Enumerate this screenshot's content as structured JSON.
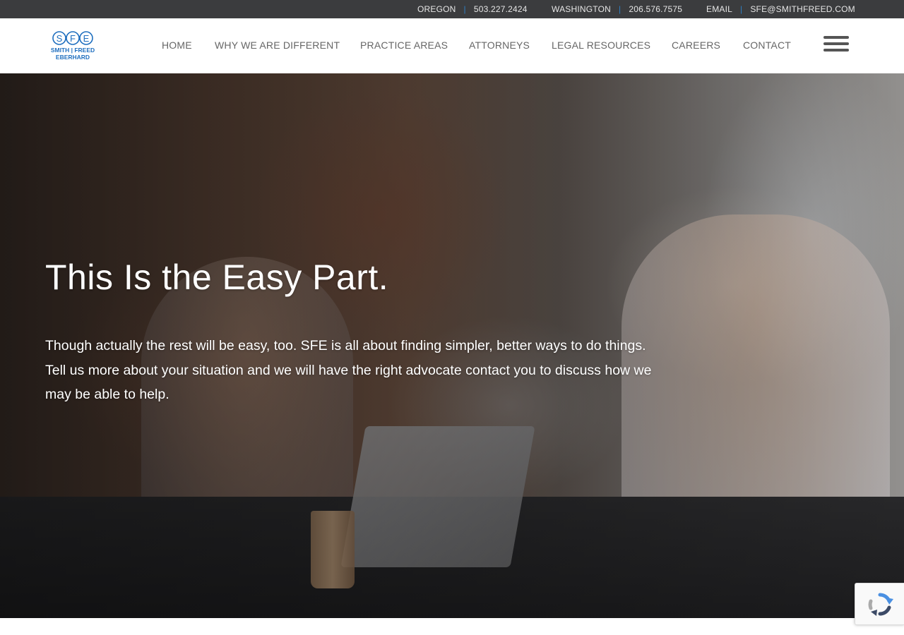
{
  "topbar": {
    "oregon": {
      "label": "OREGON",
      "phone": "503.227.2424"
    },
    "washington": {
      "label": "WASHINGTON",
      "phone": "206.576.7575"
    },
    "email": {
      "label": "EMAIL",
      "address": "SFE@SMITHFREED.COM"
    },
    "separator": "|",
    "separator_color": "#2e7fc4"
  },
  "logo": {
    "letters": [
      "S",
      "F",
      "E"
    ],
    "line1": "SMITH | FREED",
    "line2": "EBERHARD",
    "color": "#1f6fbf"
  },
  "nav": {
    "items": [
      "HOME",
      "WHY WE ARE DIFFERENT",
      "PRACTICE AREAS",
      "ATTORNEYS",
      "LEGAL RESOURCES",
      "CAREERS",
      "CONTACT"
    ],
    "menu_icon": "hamburger-menu-icon"
  },
  "hero": {
    "title": "This Is the Easy Part.",
    "body": "Though actually the rest will be easy, too. SFE is all about finding simpler, better ways to do things. Tell us more about your situation and we will have the right advocate contact you to discuss how we may be able to help."
  },
  "recaptcha": {
    "icon": "recaptcha-icon"
  }
}
